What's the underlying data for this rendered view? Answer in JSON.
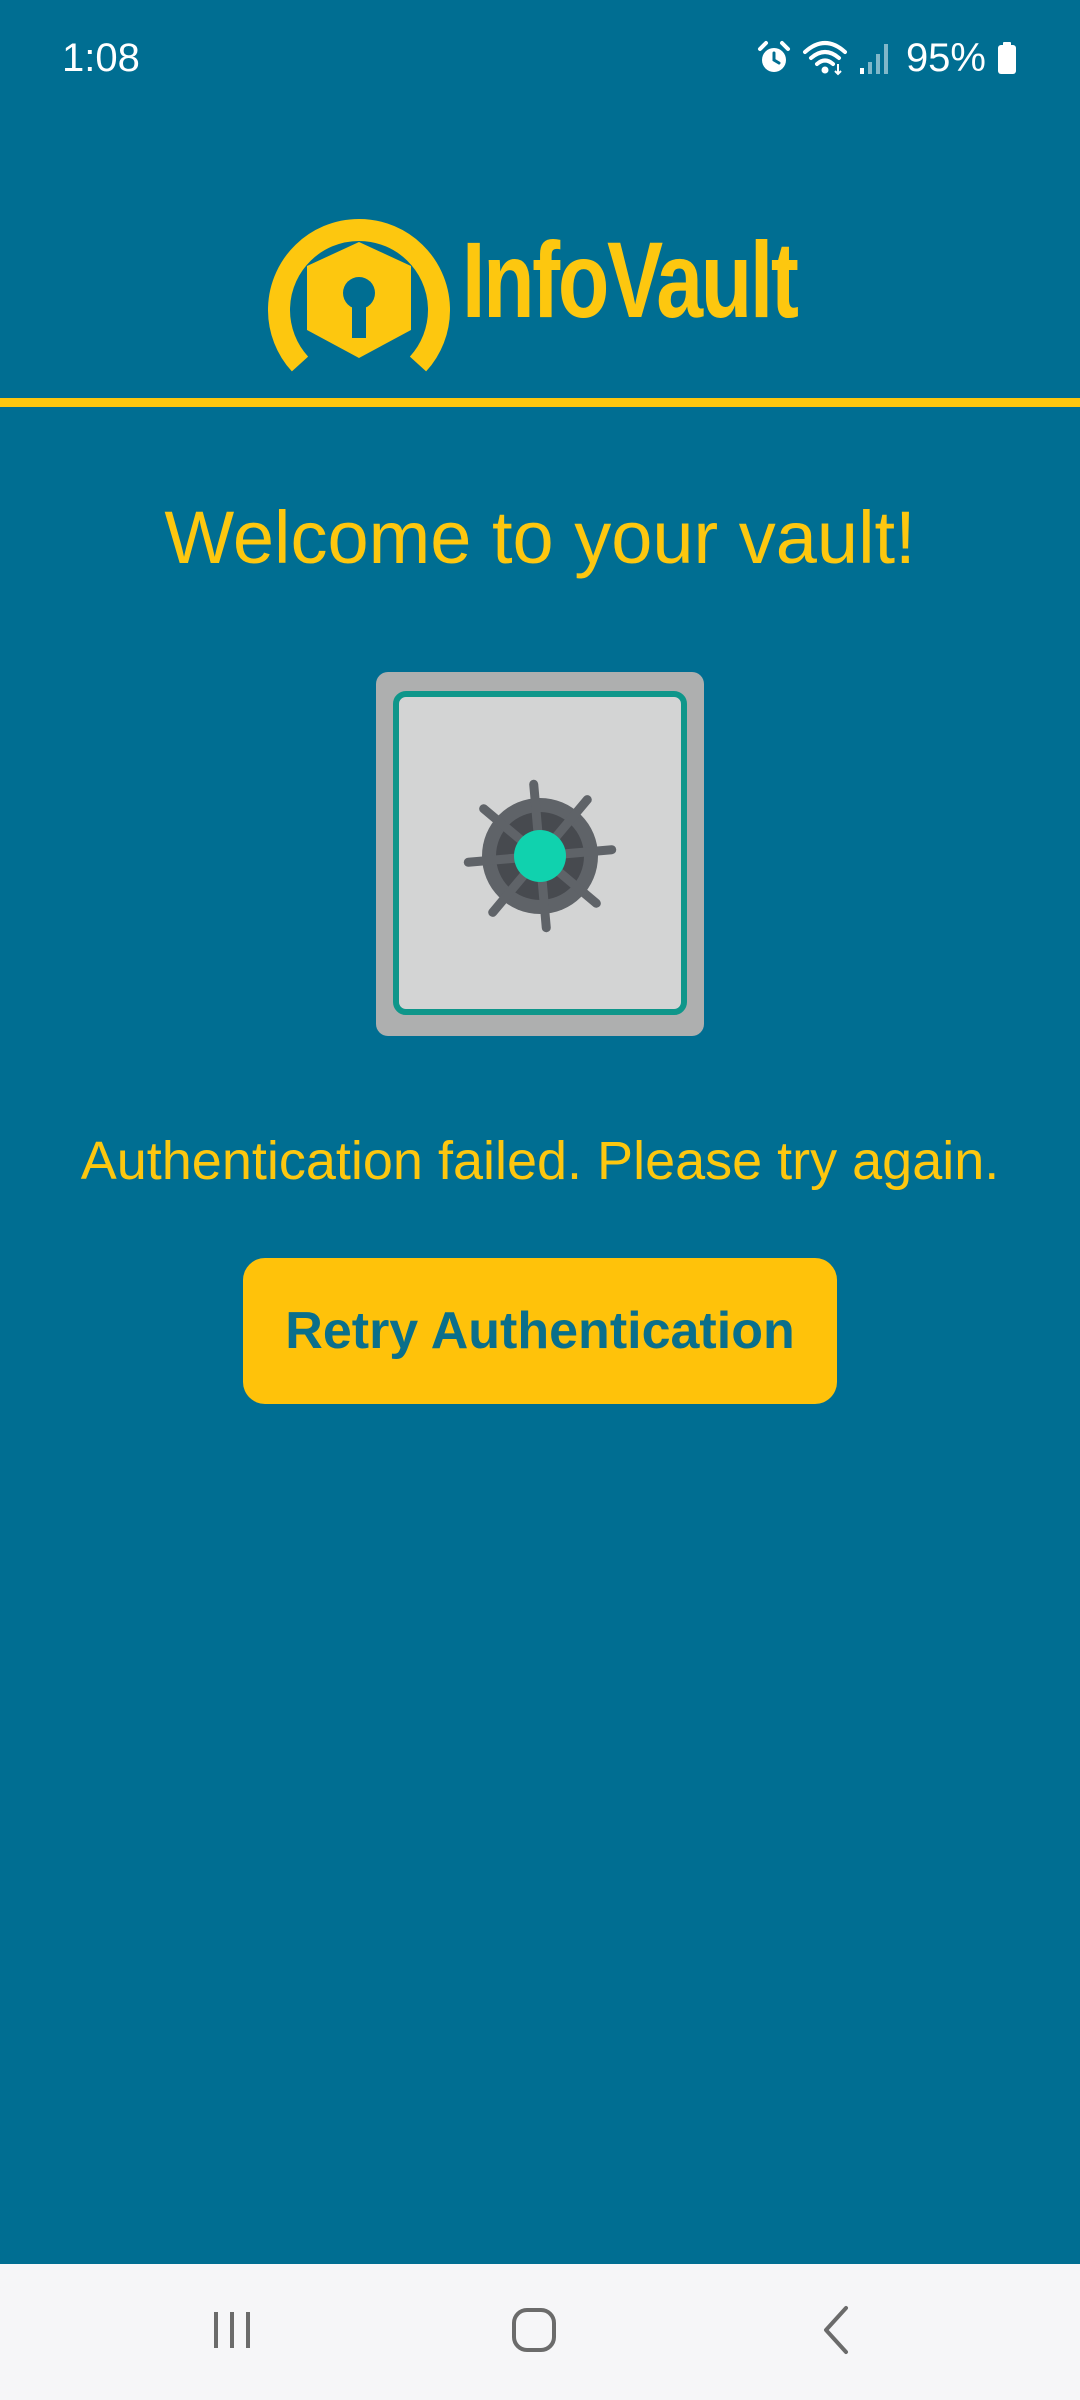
{
  "status_bar": {
    "time": "1:08",
    "battery_percent": "95%",
    "icons": [
      "alarm-icon",
      "wifi-icon",
      "signal-icon",
      "battery-icon"
    ]
  },
  "header": {
    "app_name": "InfoVault",
    "logo_icon": "vault-keyhole-logo-icon"
  },
  "main": {
    "welcome_title": "Welcome to your vault!",
    "illustration_icon": "safe-vault-icon",
    "auth_message": "Authentication failed. Please try again.",
    "retry_label": "Retry Authentication"
  },
  "nav_bar": {
    "icons": [
      "recents-icon",
      "home-icon",
      "back-icon"
    ]
  },
  "colors": {
    "background": "#006E92",
    "accent": "#FDC70F",
    "button": "#FFC20A",
    "button_text": "#0A6F8B",
    "safe_body": "#D3D4D4",
    "safe_frame": "#AEAFAF",
    "safe_border": "#0E968A",
    "dial_center": "#10D2AE",
    "nav_background": "#F6F6F8"
  }
}
